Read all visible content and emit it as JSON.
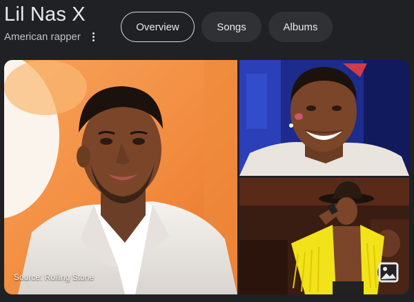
{
  "entity": {
    "title": "Lil Nas X",
    "subtitle": "American rapper",
    "more_icon": "more-vert-icon"
  },
  "tabs": [
    {
      "label": "Overview",
      "active": true
    },
    {
      "label": "Songs",
      "active": false
    },
    {
      "label": "Albums",
      "active": false
    }
  ],
  "gallery": {
    "main_source": "Source: Rolling Stone",
    "image_button_icon": "image-icon"
  },
  "colors": {
    "background": "#202124",
    "tab_bg": "#303134",
    "active_tab_border": "#dadce0",
    "text": "#e8eaed",
    "subtext": "#bdc1c6"
  }
}
